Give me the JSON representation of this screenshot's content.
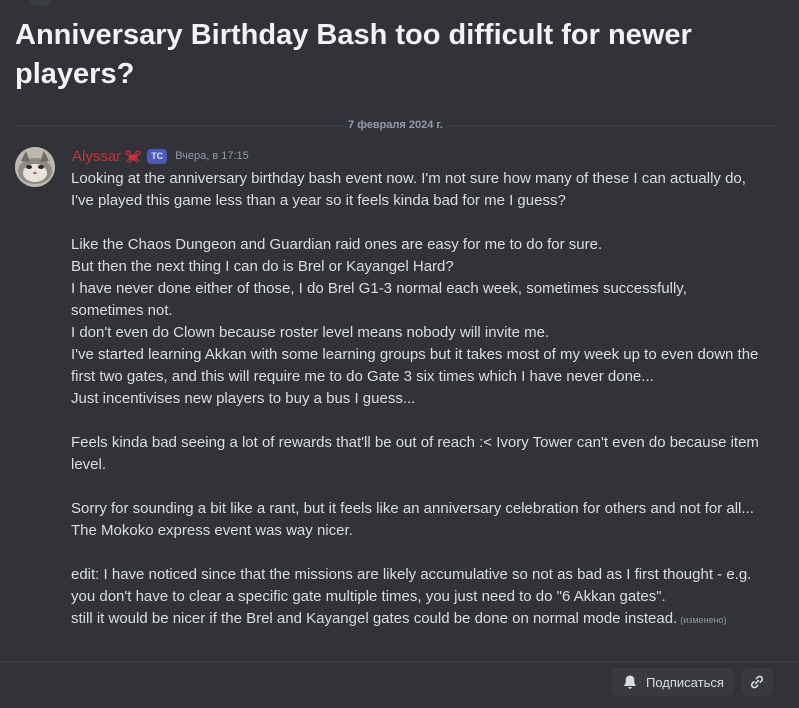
{
  "thread": {
    "title": "Anniversary Birthday Bash too difficult for newer players?"
  },
  "divider": {
    "date": "7 февраля 2024 г."
  },
  "message": {
    "author": {
      "name": "Alyssar",
      "name_color": "#c8323b",
      "role_icon": "crab-icon",
      "tag": "TC"
    },
    "timestamp": "Вчера, в 17:15",
    "lines": [
      "Looking at the anniversary birthday bash event now. I'm not sure how many of these I can actually do, I've played this game less than a year so it feels kinda bad for me I guess?",
      "",
      "Like the Chaos Dungeon and Guardian raid ones are easy for me to do for sure.",
      "But then the next thing I can do is Brel or Kayangel Hard?",
      "I have never done either of those, I do Brel G1-3 normal each week, sometimes successfully, sometimes not.",
      "I don't even do Clown because roster level means nobody will invite me.",
      "I've started learning Akkan with some learning groups but it takes most of my week up to even down the first two gates, and this will require me to do Gate 3 six times which I have never done...",
      "Just incentivises new players to buy a bus I guess...",
      "",
      "Feels kinda bad seeing a lot of rewards that'll be out of reach :< Ivory Tower can't even do because item level.",
      "",
      "Sorry for sounding a bit like a rant, but it feels like an anniversary celebration for others and not for all...",
      "The Mokoko express event was way nicer.",
      "",
      "edit: I have noticed since that the missions are likely accumulative so not as bad as I first thought - e.g. you don't have to clear a specific gate multiple times, you just need to do \"6 Akkan gates\".",
      "still it would be nicer if the Brel and Kayangel gates could be done on normal mode instead."
    ],
    "edited_label": "(изменено)"
  },
  "footer": {
    "follow_label": "Подписаться",
    "follow_icon": "bell-icon",
    "link_icon": "link-icon"
  },
  "colors": {
    "background": "#313338",
    "text": "#dbdee1",
    "muted": "#949ba4",
    "badge": "#4b5ab4"
  }
}
